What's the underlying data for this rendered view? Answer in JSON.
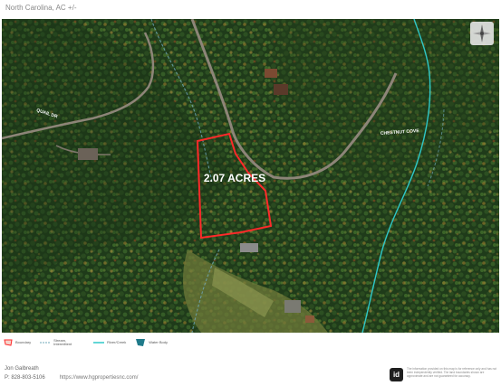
{
  "header": {
    "title": "North Carolina,  AC +/-"
  },
  "map": {
    "acreage_label": "2.07 ACRES",
    "road_labels": {
      "quail_dr": "QUAIL DR",
      "chestnut_cove": "CHESTNUT COVE"
    },
    "colors": {
      "boundary": "#ff2a2a",
      "stream": "#2ec8c8",
      "forest": "#1e3a19"
    }
  },
  "legend": {
    "items": [
      {
        "label": "Boundary",
        "icon": "boundary-icon"
      },
      {
        "label": "Stream, Intermittent",
        "icon": "stream-intermittent-icon"
      },
      {
        "label": "River/Creek",
        "icon": "river-creek-icon"
      },
      {
        "label": "Water Body",
        "icon": "water-body-icon"
      }
    ]
  },
  "footer": {
    "agent_name": "Jon  Galbreath",
    "phone": "P: 828-803-5106",
    "website": "https://www.hgpropertiesnc.com/",
    "logo_text": "id",
    "disclaimer": "The information provided on this map is for reference only and has not been independently verified. The land boundaries shown are approximate and are not guaranteed for accuracy."
  }
}
